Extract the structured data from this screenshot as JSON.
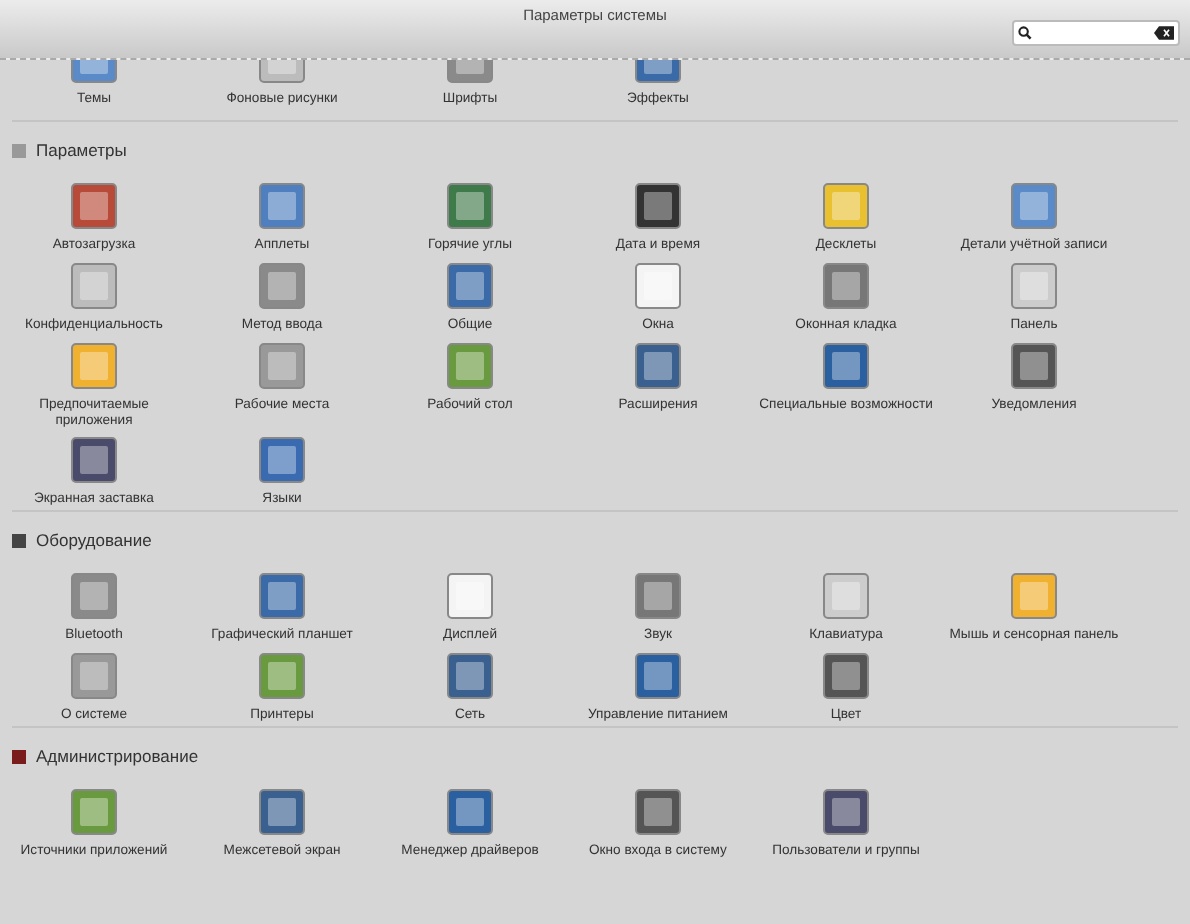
{
  "window": {
    "title": "Параметры системы"
  },
  "top_items": [
    {
      "label": "Темы"
    },
    {
      "label": "Фоновые рисунки"
    },
    {
      "label": "Шрифты"
    },
    {
      "label": "Эффекты"
    }
  ],
  "sections": [
    {
      "title": "Параметры",
      "items": [
        {
          "label": "Автозагрузка"
        },
        {
          "label": "Апплеты"
        },
        {
          "label": "Горячие углы"
        },
        {
          "label": "Дата и время"
        },
        {
          "label": "Десклеты"
        },
        {
          "label": "Детали учётной записи"
        },
        {
          "label": "Конфиденциальность"
        },
        {
          "label": "Метод ввода"
        },
        {
          "label": "Общие"
        },
        {
          "label": "Окна"
        },
        {
          "label": "Оконная кладка"
        },
        {
          "label": "Панель"
        },
        {
          "label": "Предпочитаемые приложения"
        },
        {
          "label": "Рабочие места"
        },
        {
          "label": "Рабочий стол"
        },
        {
          "label": "Расширения"
        },
        {
          "label": "Специальные возможности"
        },
        {
          "label": "Уведомления"
        },
        {
          "label": "Экранная заставка"
        },
        {
          "label": "Языки"
        }
      ]
    },
    {
      "title": "Оборудование",
      "items": [
        {
          "label": "Bluetooth"
        },
        {
          "label": "Графический планшет"
        },
        {
          "label": "Дисплей"
        },
        {
          "label": "Звук"
        },
        {
          "label": "Клавиатура"
        },
        {
          "label": "Мышь и сенсорная панель"
        },
        {
          "label": "О системе"
        },
        {
          "label": "Принтеры"
        },
        {
          "label": "Сеть"
        },
        {
          "label": "Управление питанием"
        },
        {
          "label": "Цвет"
        }
      ]
    },
    {
      "title": "Администрирование",
      "items": [
        {
          "label": "Источники приложений"
        },
        {
          "label": "Межсетевой экран"
        },
        {
          "label": "Менеджер драйверов"
        },
        {
          "label": "Окно входа в систему"
        },
        {
          "label": "Пользователи и группы"
        }
      ]
    }
  ]
}
